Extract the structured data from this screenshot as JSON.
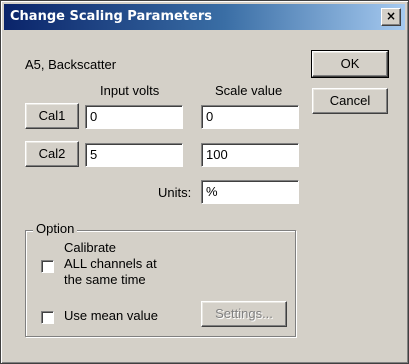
{
  "dialog": {
    "title": "Change Scaling Parameters",
    "close_label": "×",
    "channel_label": "A5, Backscatter",
    "input_volts_header": "Input volts",
    "scale_value_header": "Scale value",
    "cal1": {
      "button_label": "Cal1",
      "input_volts": "0",
      "scale_value": "0"
    },
    "cal2": {
      "button_label": "Cal2",
      "input_volts": "5",
      "scale_value": "100"
    },
    "units_label": "Units:",
    "units_value": "%",
    "ok_label": "OK",
    "cancel_label": "Cancel",
    "option": {
      "legend": "Option",
      "calibrate_line1": "Calibrate",
      "calibrate_line2": "ALL channels at",
      "calibrate_line3": "the same time",
      "calibrate_checked": false,
      "mean_label": "Use mean value",
      "mean_checked": false,
      "settings_label": "Settings..."
    }
  }
}
